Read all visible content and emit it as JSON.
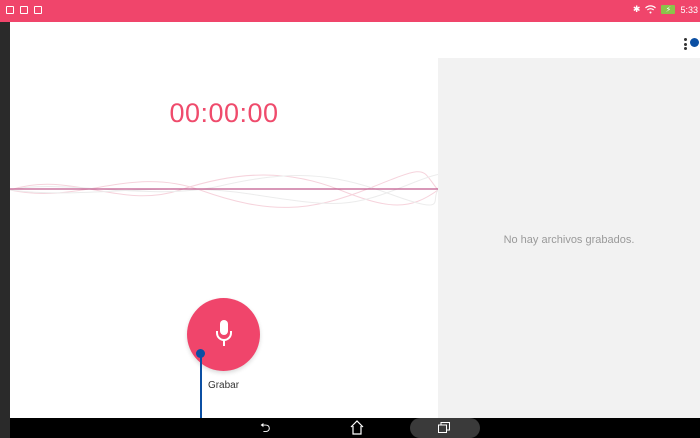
{
  "status_bar": {
    "time": "5:33",
    "left_icons": [
      "notification-icon",
      "notification-icon",
      "notification-icon"
    ],
    "right_icons": [
      "bluetooth-icon",
      "wifi-icon",
      "battery-icon"
    ]
  },
  "timer": {
    "value": "00:00:00"
  },
  "list_panel": {
    "empty_message": "No hay archivos grabados."
  },
  "record": {
    "label": "Grabar"
  },
  "colors": {
    "accent": "#f0456b",
    "timer": "#ef4b6c",
    "panel_bg": "#f2f2f2",
    "annotation": "#0b4fa3"
  }
}
